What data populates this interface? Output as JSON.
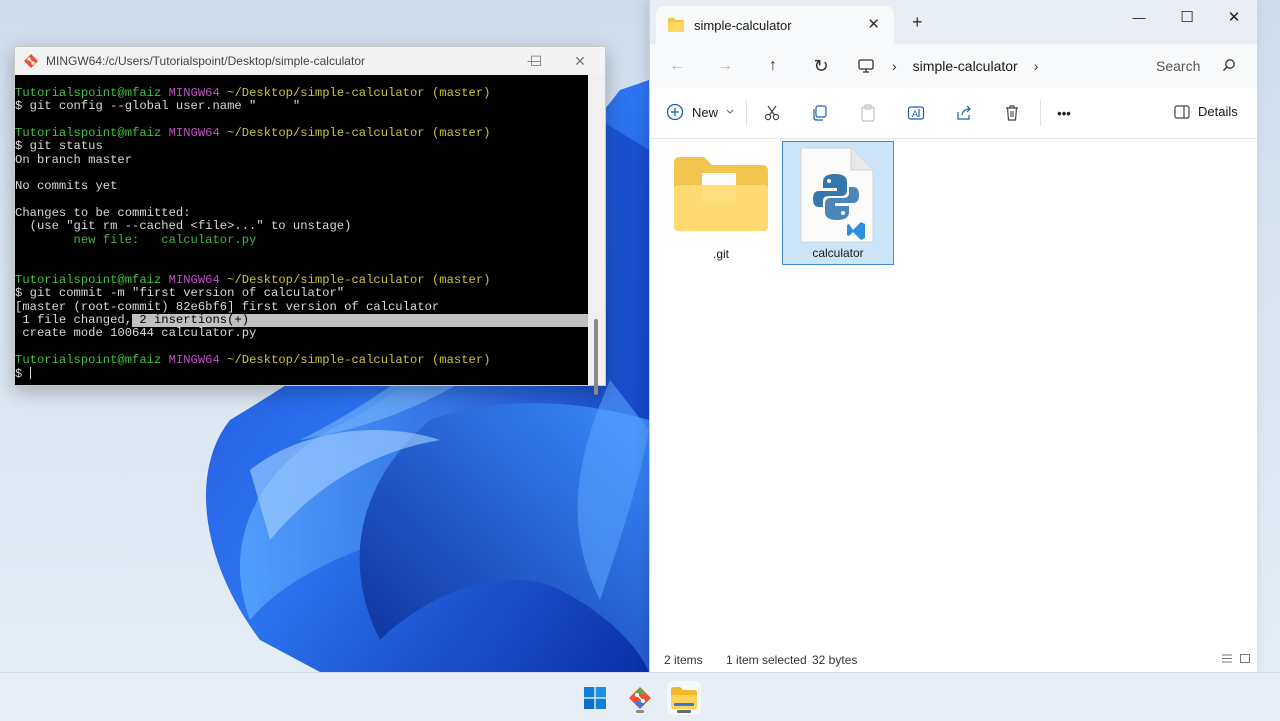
{
  "terminal": {
    "title": "MINGW64:/c/Users/Tutorialspoint/Desktop/simple-calculator",
    "window_controls": {
      "minimize": "—",
      "maximize": "☐",
      "close": "✕"
    },
    "prompt": {
      "user": "Tutorialspoint@mfaiz",
      "shell": "MINGW64",
      "path": "~/Desktop/simple-calculator",
      "branch": "(master)"
    },
    "lines": {
      "l1_prompt": true,
      "l2": "$ git config --global user.name \"     \"",
      "l4": "$ git status",
      "l5": "On branch master",
      "l7": "No commits yet",
      "l9": "Changes to be committed:",
      "l10": "  (use \"git rm --cached <file>...\" to unstage)",
      "l11": "        new file:   calculator.py",
      "l15": "$ git commit -m \"first version of calculator\"",
      "l16": "[master (root-commit) 82e6bf6] first version of calculator",
      "l17a": " 1 file changed,",
      "l17b": " 2 insertions(+)",
      "l18": " create mode 100644 calculator.py",
      "l20": "$ "
    }
  },
  "explorer": {
    "tab_label": "simple-calculator",
    "tab_close": "✕",
    "new_tab": "+",
    "window_controls": {
      "minimize": "—",
      "maximize": "☐",
      "close": "✕"
    },
    "nav": {
      "back": "←",
      "forward": "→",
      "up": "↑",
      "refresh": "↻"
    },
    "breadcrumb": {
      "current": "simple-calculator",
      "sep": "›"
    },
    "search_placeholder": "Search",
    "toolbar": {
      "new_label": "New",
      "details_label": "Details",
      "more": "•••"
    },
    "items": [
      {
        "name": ".git",
        "type": "folder",
        "selected": false
      },
      {
        "name": "calculator",
        "type": "python-file",
        "selected": true
      }
    ],
    "status": {
      "count": "2 items",
      "selection": "1 item selected",
      "size": "32 bytes"
    }
  },
  "colors": {
    "terminal_bg": "#000000",
    "prompt_user": "#3ec23e",
    "prompt_shell": "#c14fc1",
    "prompt_path": "#c7c43a",
    "selection_bg": "#cce4f7",
    "selection_border": "#3f8fd2"
  },
  "taskbar": {
    "items": [
      "windows-start-icon",
      "git-icon",
      "file-explorer-icon"
    ]
  }
}
